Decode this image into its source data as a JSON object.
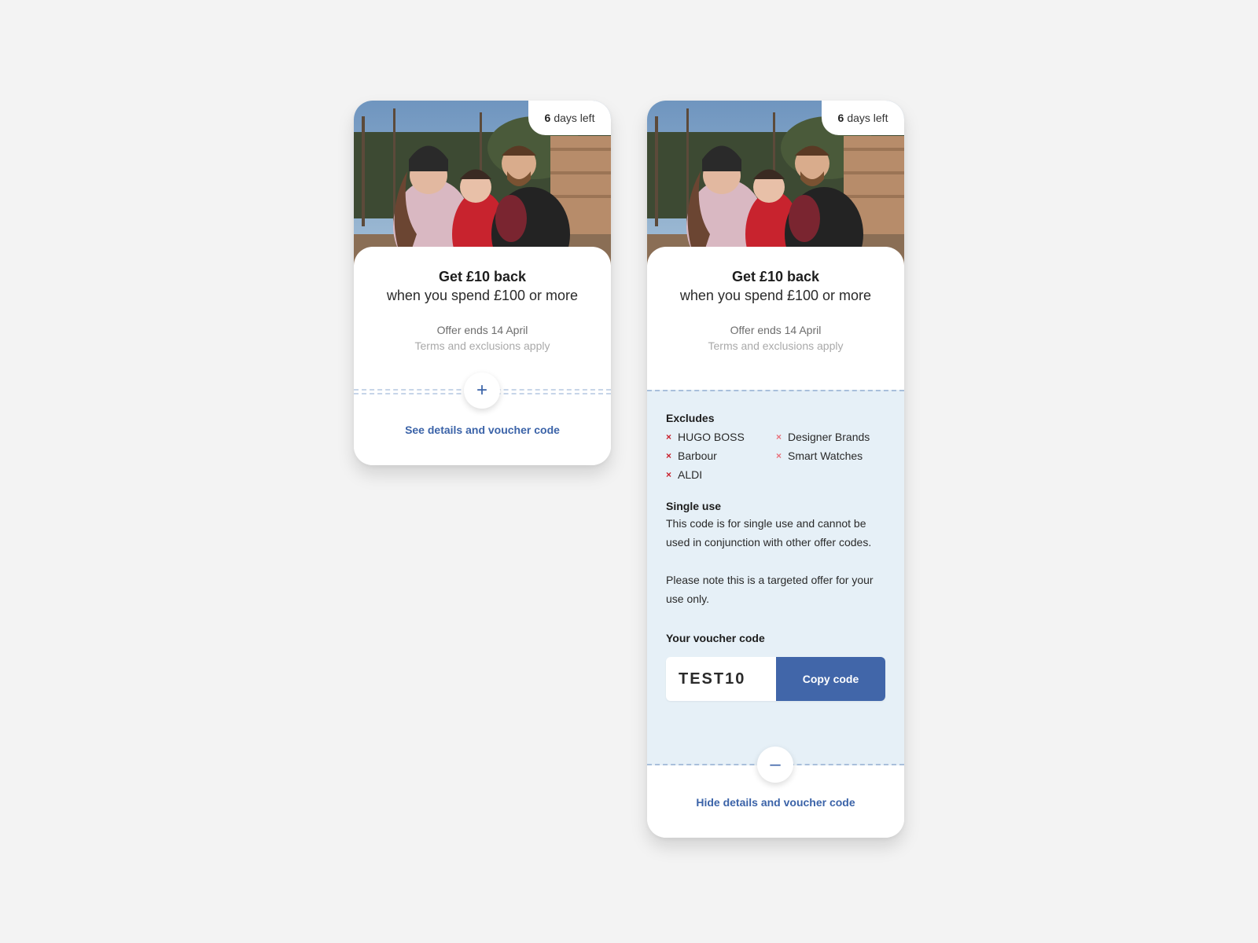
{
  "cards": [
    {
      "days_left_number": "6",
      "days_left_text": "days left",
      "headline": "Get £10 back",
      "subline": "when you spend £100 or more",
      "offer_ends": "Offer ends 14 April",
      "terms": "Terms and exclusions apply",
      "toggle_icon": "plus-icon",
      "toggle_symbol": "+",
      "toggle_label": "See details and voucher code"
    },
    {
      "days_left_number": "6",
      "days_left_text": "days left",
      "headline": "Get £10 back",
      "subline": "when you spend £100 or more",
      "offer_ends": "Offer ends 14 April",
      "terms": "Terms and exclusions apply",
      "excludes_title": "Excludes",
      "excludes": [
        "HUGO BOSS",
        "Designer Brands",
        "Barbour",
        "Smart Watches",
        "ALDI"
      ],
      "single_use_title": "Single use",
      "single_use_text": "This code is for single use and cannot be used in conjunction with other offer codes.",
      "targeted_text": "Please note this is a targeted offer for your use only.",
      "voucher_title": "Your voucher code",
      "voucher_code": "TEST10",
      "copy_label": "Copy code",
      "toggle_icon": "minus-icon",
      "toggle_symbol": "–",
      "toggle_label": "Hide details and voucher code"
    }
  ],
  "colors": {
    "page_bg": "#f3f3f3",
    "accent": "#3b63a8",
    "copy_button": "#4166a9",
    "details_bg": "#e6f0f7",
    "exclude_mark": "#c9202c"
  },
  "icons": {
    "exclude": "x-icon",
    "exclude_symbol": "×"
  }
}
